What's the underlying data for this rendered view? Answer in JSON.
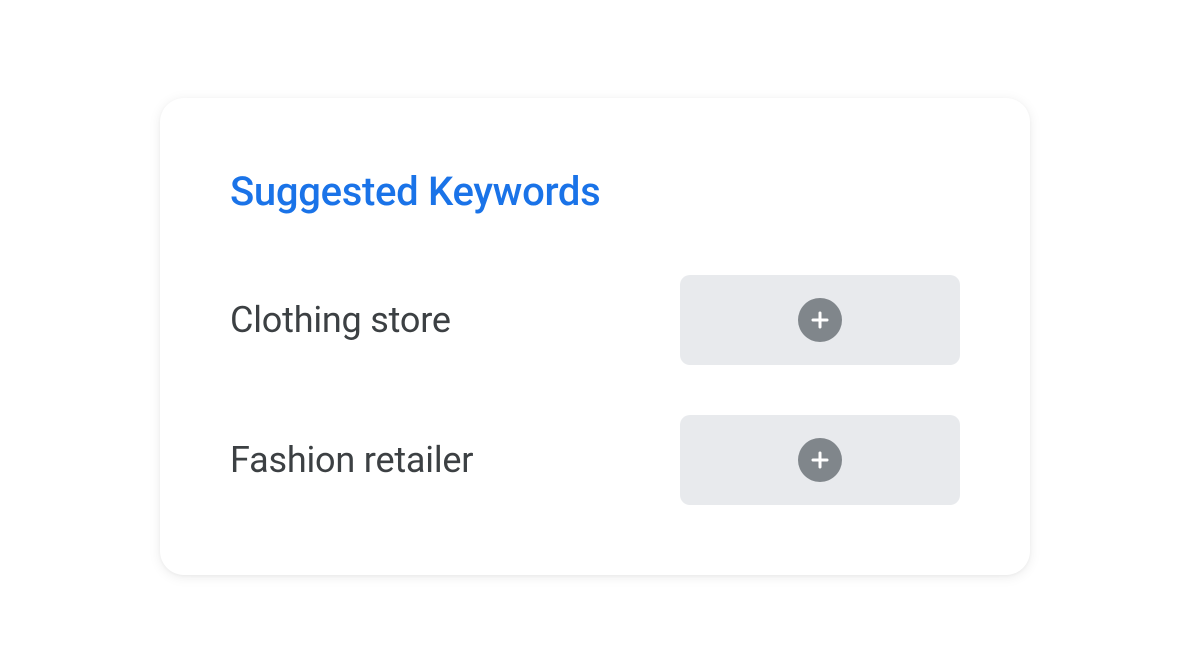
{
  "card": {
    "title": "Suggested Keywords",
    "keywords": [
      {
        "label": "Clothing store"
      },
      {
        "label": "Fashion retailer"
      }
    ]
  }
}
